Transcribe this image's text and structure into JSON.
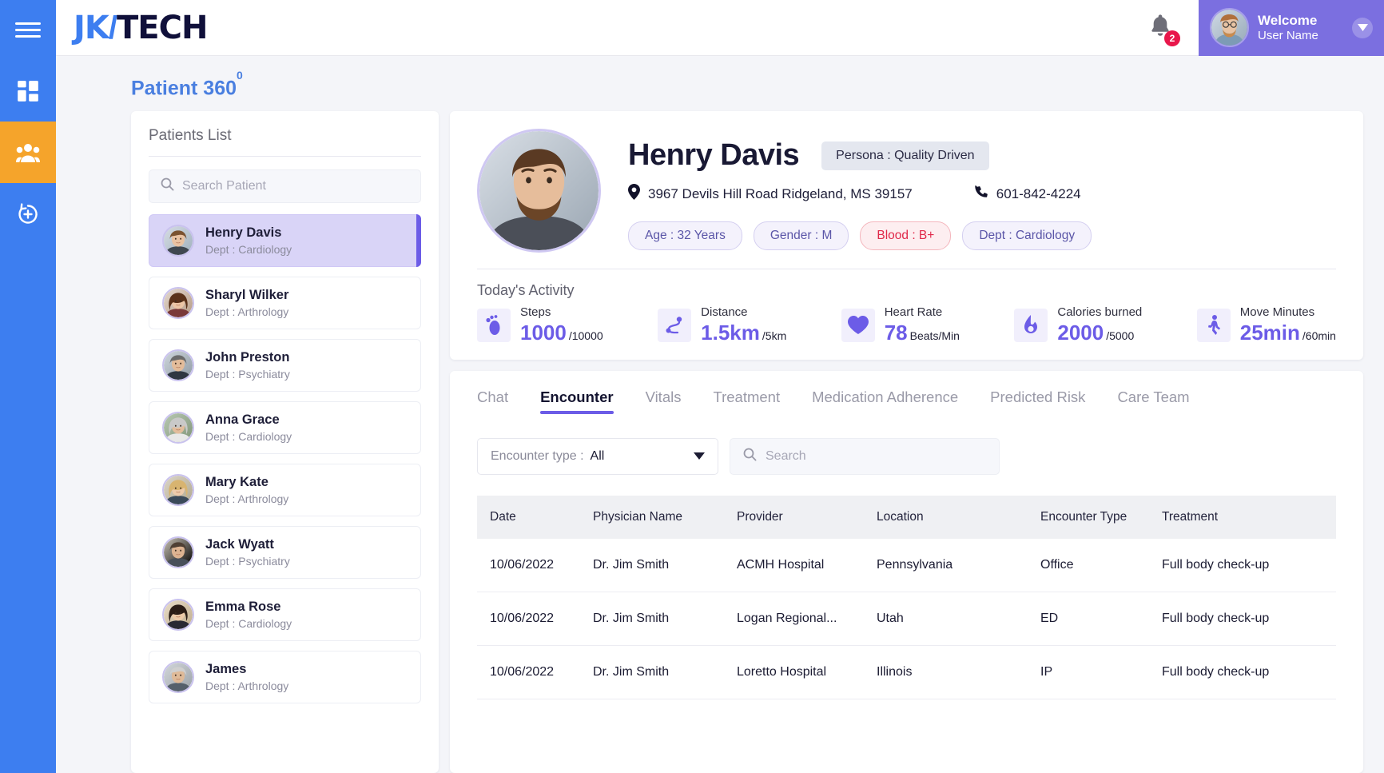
{
  "rail": {
    "menu_icon": "hamburger-icon",
    "items": [
      {
        "icon": "dashboard-grid-icon",
        "name": "dashboard",
        "active": false
      },
      {
        "icon": "patients-group-icon",
        "name": "patients",
        "active": true
      },
      {
        "icon": "medical-refresh-icon",
        "name": "care-cycle",
        "active": false
      }
    ],
    "colors": {
      "bg": "#3d7ef0",
      "active_bg": "#f5a42b"
    }
  },
  "topbar": {
    "logo": {
      "part1": "JK",
      "slash": "/",
      "part2": "TECH"
    },
    "notifications": {
      "icon": "bell-icon",
      "count": "2",
      "badge_color": "#e8174b"
    },
    "user": {
      "greeting": "Welcome",
      "name": "User Name",
      "avatar": "user-avatar",
      "caret": "chevron-down-icon",
      "bg_color": "#7b6fe0"
    }
  },
  "page": {
    "title": "Patient 360",
    "title_sup": "0",
    "title_color": "#4a7fe0"
  },
  "patients_panel": {
    "title": "Patients List",
    "search": {
      "placeholder": "Search Patient",
      "value": "",
      "icon": "search-icon"
    },
    "items": [
      {
        "name": "Henry Davis",
        "dept": "Dept : Cardiology",
        "selected": true
      },
      {
        "name": "Sharyl Wilker",
        "dept": "Dept : Arthrology",
        "selected": false
      },
      {
        "name": "John Preston",
        "dept": "Dept : Psychiatry",
        "selected": false
      },
      {
        "name": "Anna Grace",
        "dept": "Dept : Cardiology",
        "selected": false
      },
      {
        "name": "Mary Kate",
        "dept": "Dept : Arthrology",
        "selected": false
      },
      {
        "name": "Jack Wyatt",
        "dept": "Dept : Psychiatry",
        "selected": false
      },
      {
        "name": "Emma Rose",
        "dept": "Dept : Cardiology",
        "selected": false
      },
      {
        "name": "James",
        "dept": "Dept : Arthrology",
        "selected": false
      }
    ]
  },
  "patient": {
    "name": "Henry Davis",
    "persona": "Persona : Quality Driven",
    "address": "3967 Devils Hill Road Ridgeland, MS 39157",
    "phone": "601-842-4224",
    "address_icon": "location-pin-icon",
    "phone_icon": "phone-icon",
    "pills": [
      {
        "label": "Age : 32 Years",
        "type": "normal"
      },
      {
        "label": "Gender : M",
        "type": "normal"
      },
      {
        "label": "Blood : B+",
        "type": "blood"
      },
      {
        "label": "Dept : Cardiology",
        "type": "normal"
      }
    ]
  },
  "activity": {
    "title": "Today's Activity",
    "accent_color": "#6c5ce7",
    "metrics": [
      {
        "icon": "footsteps-icon",
        "label": "Steps",
        "value": "1000",
        "sub": "/10000"
      },
      {
        "icon": "route-icon",
        "label": "Distance",
        "value": "1.5km",
        "sub": "/5km"
      },
      {
        "icon": "heart-icon",
        "label": "Heart Rate",
        "value": "78",
        "sub": "Beats/Min"
      },
      {
        "icon": "flame-icon",
        "label": "Calories burned",
        "value": "2000",
        "sub": "/5000"
      },
      {
        "icon": "walking-icon",
        "label": "Move Minutes",
        "value": "25min",
        "sub": "/60min"
      }
    ]
  },
  "tabs": [
    {
      "label": "Chat",
      "active": false
    },
    {
      "label": "Encounter",
      "active": true
    },
    {
      "label": "Vitals",
      "active": false
    },
    {
      "label": "Treatment",
      "active": false
    },
    {
      "label": "Medication Adherence",
      "active": false
    },
    {
      "label": "Predicted Risk",
      "active": false
    },
    {
      "label": "Care Team",
      "active": false
    }
  ],
  "encounter_filters": {
    "select_label": "Encounter type :",
    "select_value": "All",
    "select_caret": "chevron-down-icon",
    "search": {
      "placeholder": "Search",
      "value": "",
      "icon": "search-icon"
    }
  },
  "encounter_table": {
    "columns": [
      "Date",
      "Physician Name",
      "Provider",
      "Location",
      "Encounter Type",
      "Treatment"
    ],
    "rows": [
      [
        "10/06/2022",
        "Dr. Jim Smith",
        "ACMH Hospital",
        "Pennsylvania",
        "Office",
        "Full body check-up"
      ],
      [
        "10/06/2022",
        "Dr. Jim Smith",
        "Logan Regional...",
        "Utah",
        "ED",
        "Full body check-up"
      ],
      [
        "10/06/2022",
        "Dr. Jim Smith",
        "Loretto Hospital",
        "Illinois",
        "IP",
        "Full body check-up"
      ]
    ]
  }
}
